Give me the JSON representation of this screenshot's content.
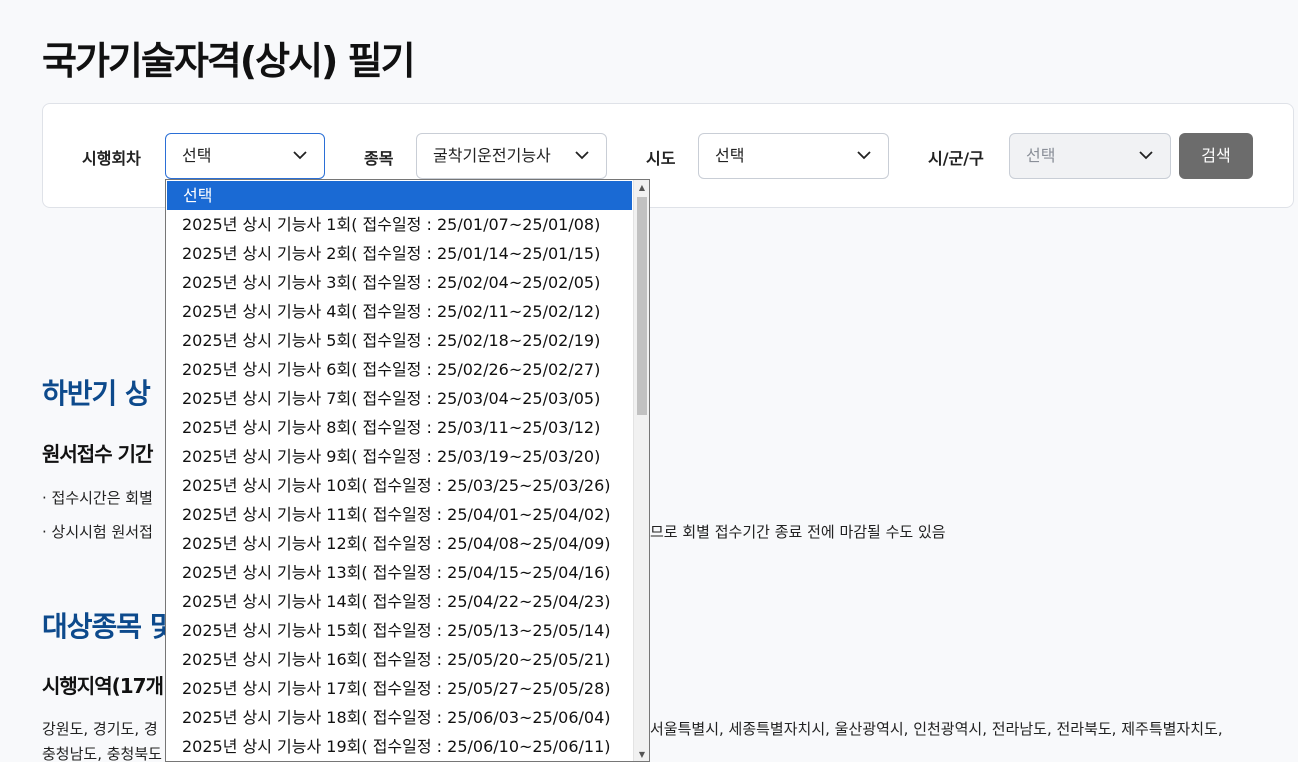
{
  "page": {
    "title": "국가기술자격(상시) 필기"
  },
  "filters": {
    "round_label": "시행회차",
    "round_value": "선택",
    "item_label": "종목",
    "item_value": "굴착기운전기능사",
    "sido_label": "시도",
    "sido_value": "선택",
    "sigungu_label": "시/군/구",
    "sigungu_value": "선택",
    "search_label": "검색"
  },
  "dropdown": {
    "options": [
      "선택",
      "2025년 상시 기능사 1회( 접수일정 : 25/01/07~25/01/08)",
      "2025년 상시 기능사 2회( 접수일정 : 25/01/14~25/01/15)",
      "2025년 상시 기능사 3회( 접수일정 : 25/02/04~25/02/05)",
      "2025년 상시 기능사 4회( 접수일정 : 25/02/11~25/02/12)",
      "2025년 상시 기능사 5회( 접수일정 : 25/02/18~25/02/19)",
      "2025년 상시 기능사 6회( 접수일정 : 25/02/26~25/02/27)",
      "2025년 상시 기능사 7회( 접수일정 : 25/03/04~25/03/05)",
      "2025년 상시 기능사 8회( 접수일정 : 25/03/11~25/03/12)",
      "2025년 상시 기능사 9회( 접수일정 : 25/03/19~25/03/20)",
      "2025년 상시 기능사 10회( 접수일정 : 25/03/25~25/03/26)",
      "2025년 상시 기능사 11회( 접수일정 : 25/04/01~25/04/02)",
      "2025년 상시 기능사 12회( 접수일정 : 25/04/08~25/04/09)",
      "2025년 상시 기능사 13회( 접수일정 : 25/04/15~25/04/16)",
      "2025년 상시 기능사 14회( 접수일정 : 25/04/22~25/04/23)",
      "2025년 상시 기능사 15회( 접수일정 : 25/05/13~25/05/14)",
      "2025년 상시 기능사 16회( 접수일정 : 25/05/20~25/05/21)",
      "2025년 상시 기능사 17회( 접수일정 : 25/05/27~25/05/28)",
      "2025년 상시 기능사 18회( 접수일정 : 25/06/03~25/06/04)",
      "2025년 상시 기능사 19회( 접수일정 : 25/06/10~25/06/11)"
    ]
  },
  "content": {
    "section1_title": "하반기 상",
    "section1_sub": "원서접수 기간",
    "bullet1": "· 접수시간은 회별",
    "bullet2": "· 상시시험 원서접",
    "bullet2_tail": "므로 회별 접수기간 종료 전에 마감될 수도 있음",
    "section2_title": "대상종목 및",
    "section2_sub": "시행지역(17개",
    "regions_line1": "강원도, 경기도, 경",
    "regions_line1_tail": "서울특별시, 세종특별자치시, 울산광역시, 인천광역시, 전라남도, 전라북도, 제주특별자치도,",
    "regions_line2": "충청남도, 충청북도"
  }
}
